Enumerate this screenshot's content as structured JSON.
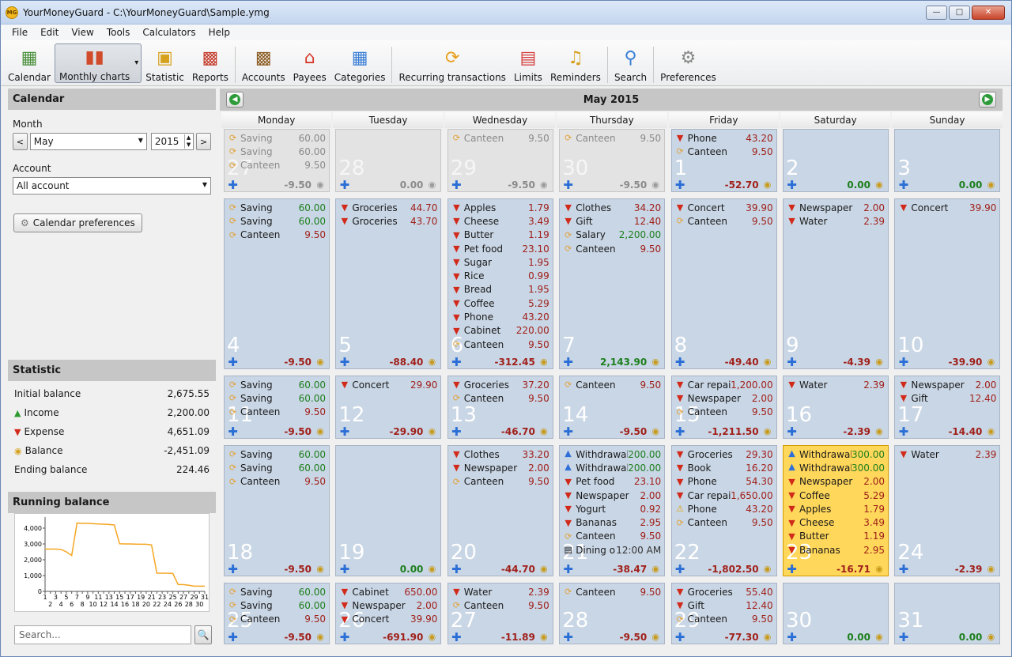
{
  "window": {
    "title": "YourMoneyGuard - C:\\YourMoneyGuard\\Sample.ymg",
    "icon_text": "MG"
  },
  "menu": [
    "File",
    "Edit",
    "View",
    "Tools",
    "Calculators",
    "Help"
  ],
  "toolbar": [
    {
      "label": "Calendar",
      "icon": "calendar-icon"
    },
    {
      "label": "Monthly charts",
      "icon": "bar-chart-icon",
      "active": true
    },
    {
      "label": "Statistic",
      "icon": "coins-table-icon"
    },
    {
      "label": "Reports",
      "icon": "report-icon"
    },
    {
      "label": "Accounts",
      "icon": "wallet-icon"
    },
    {
      "label": "Payees",
      "icon": "shop-icon"
    },
    {
      "label": "Categories",
      "icon": "grid-icon"
    },
    {
      "label": "Recurring transactions",
      "icon": "recycle-icon"
    },
    {
      "label": "Limits",
      "icon": "limits-icon"
    },
    {
      "label": "Reminders",
      "icon": "bell-icon"
    },
    {
      "label": "Search",
      "icon": "magnifier-icon"
    },
    {
      "label": "Preferences",
      "icon": "gear-icon"
    }
  ],
  "left": {
    "calendar_title": "Calendar",
    "month_label": "Month",
    "month_value": "May",
    "year_value": "2015",
    "prev": "<",
    "next": ">",
    "account_label": "Account",
    "account_value": "All account",
    "cal_prefs": "Calendar preferences",
    "statistic_title": "Statistic",
    "stats": [
      {
        "label": "Initial balance",
        "value": "2,675.55",
        "icon": ""
      },
      {
        "label": "Income",
        "value": "2,200.00",
        "icon": "up-arrow-icon"
      },
      {
        "label": "Expense",
        "value": "4,651.09",
        "icon": "down-arrow-icon"
      },
      {
        "label": "Balance",
        "value": "-2,451.09",
        "icon": "coins-icon"
      },
      {
        "label": "Ending balance",
        "value": "224.46",
        "icon": ""
      }
    ],
    "running_title": "Running balance",
    "search_placeholder": "Search..."
  },
  "calendar": {
    "month_title": "May 2015",
    "days": [
      "Monday",
      "Tuesday",
      "Wednesday",
      "Thursday",
      "Friday",
      "Saturday",
      "Sunday"
    ]
  },
  "chart_data": {
    "type": "line",
    "x": [
      1,
      2,
      3,
      4,
      5,
      6,
      7,
      8,
      9,
      10,
      11,
      12,
      13,
      14,
      15,
      16,
      17,
      18,
      19,
      20,
      21,
      22,
      23,
      24,
      25,
      26,
      27,
      28,
      29,
      30,
      31
    ],
    "values": [
      2676,
      2676,
      2676,
      2653,
      2500,
      2270,
      4320,
      4300,
      4300,
      4280,
      4260,
      4250,
      4230,
      4200,
      3010,
      3000,
      3000,
      2990,
      2980,
      2980,
      2940,
      1150,
      1150,
      1150,
      1130,
      430,
      430,
      390,
      330,
      330,
      330
    ],
    "yticks": [
      "0",
      "1,000",
      "2,000",
      "3,000",
      "4,000"
    ],
    "ylim": [
      0,
      4500
    ],
    "xticks_top": [
      "1",
      "3",
      "5",
      "7",
      "9",
      "11",
      "13",
      "15",
      "17",
      "19",
      "21",
      "23",
      "25",
      "27",
      "29",
      "31"
    ],
    "xticks_bottom": [
      "2",
      "4",
      "6",
      "8",
      "10",
      "12",
      "14",
      "16",
      "18",
      "20",
      "22",
      "24",
      "26",
      "28",
      "30"
    ],
    "color": "#f5a623"
  },
  "weeks": [
    [
      {
        "d": "27",
        "other": true,
        "tx": [
          [
            "rec",
            "Saving",
            "60.00"
          ],
          [
            "rec",
            "Saving",
            "60.00"
          ],
          [
            "rec",
            "Canteen",
            "9.50"
          ]
        ],
        "total": "-9.50"
      },
      {
        "d": "28",
        "other": true,
        "tx": [],
        "total": "0.00"
      },
      {
        "d": "29",
        "other": true,
        "tx": [
          [
            "rec",
            "Canteen",
            "9.50"
          ]
        ],
        "total": "-9.50"
      },
      {
        "d": "30",
        "other": true,
        "tx": [
          [
            "rec",
            "Canteen",
            "9.50"
          ]
        ],
        "total": "-9.50"
      },
      {
        "d": "1",
        "tx": [
          [
            "down",
            "Phone",
            "43.20"
          ],
          [
            "rec",
            "Canteen",
            "9.50"
          ]
        ],
        "total": "-52.70"
      },
      {
        "d": "2",
        "tx": [],
        "total": "0.00"
      },
      {
        "d": "3",
        "tx": [],
        "total": "0.00"
      }
    ],
    [
      {
        "d": "4",
        "tx": [
          [
            "rec",
            "Saving",
            "60.00"
          ],
          [
            "rec",
            "Saving",
            "60.00"
          ],
          [
            "rec",
            "Canteen",
            "9.50"
          ]
        ],
        "total": "-9.50"
      },
      {
        "d": "5",
        "tx": [
          [
            "down",
            "Groceries",
            "44.70"
          ],
          [
            "down",
            "Groceries",
            "43.70"
          ]
        ],
        "total": "-88.40"
      },
      {
        "d": "6",
        "tx": [
          [
            "down",
            "Apples",
            "1.79"
          ],
          [
            "down",
            "Cheese",
            "3.49"
          ],
          [
            "down",
            "Butter",
            "1.19"
          ],
          [
            "down",
            "Pet food",
            "23.10"
          ],
          [
            "down",
            "Sugar",
            "1.95"
          ],
          [
            "down",
            "Rice",
            "0.99"
          ],
          [
            "down",
            "Bread",
            "1.95"
          ],
          [
            "down",
            "Coffee",
            "5.29"
          ],
          [
            "down",
            "Phone",
            "43.20"
          ],
          [
            "down",
            "Cabinet",
            "220.00"
          ],
          [
            "rec",
            "Canteen",
            "9.50"
          ]
        ],
        "total": "-312.45"
      },
      {
        "d": "7",
        "tx": [
          [
            "down",
            "Clothes",
            "34.20"
          ],
          [
            "down",
            "Gift",
            "12.40"
          ],
          [
            "rec",
            "Salary",
            "2,200.00"
          ],
          [
            "rec",
            "Canteen",
            "9.50"
          ]
        ],
        "total": "2,143.90"
      },
      {
        "d": "8",
        "tx": [
          [
            "down",
            "Concert",
            "39.90"
          ],
          [
            "rec",
            "Canteen",
            "9.50"
          ]
        ],
        "total": "-49.40"
      },
      {
        "d": "9",
        "tx": [
          [
            "down",
            "Newspaper",
            "2.00"
          ],
          [
            "down",
            "Water",
            "2.39"
          ]
        ],
        "total": "-4.39"
      },
      {
        "d": "10",
        "tx": [
          [
            "down",
            "Concert",
            "39.90"
          ]
        ],
        "total": "-39.90"
      }
    ],
    [
      {
        "d": "11",
        "tx": [
          [
            "rec",
            "Saving",
            "60.00"
          ],
          [
            "rec",
            "Saving",
            "60.00"
          ],
          [
            "rec",
            "Canteen",
            "9.50"
          ]
        ],
        "total": "-9.50"
      },
      {
        "d": "12",
        "tx": [
          [
            "down",
            "Concert",
            "29.90"
          ]
        ],
        "total": "-29.90"
      },
      {
        "d": "13",
        "tx": [
          [
            "down",
            "Groceries",
            "37.20"
          ],
          [
            "rec",
            "Canteen",
            "9.50"
          ]
        ],
        "total": "-46.70"
      },
      {
        "d": "14",
        "tx": [
          [
            "rec",
            "Canteen",
            "9.50"
          ]
        ],
        "total": "-9.50"
      },
      {
        "d": "15",
        "tx": [
          [
            "down",
            "Car repair",
            "1,200.00"
          ],
          [
            "down",
            "Newspaper",
            "2.00"
          ],
          [
            "rec",
            "Canteen",
            "9.50"
          ]
        ],
        "total": "-1,211.50"
      },
      {
        "d": "16",
        "tx": [
          [
            "down",
            "Water",
            "2.39"
          ]
        ],
        "total": "-2.39"
      },
      {
        "d": "17",
        "tx": [
          [
            "down",
            "Newspaper",
            "2.00"
          ],
          [
            "down",
            "Gift",
            "12.40"
          ]
        ],
        "total": "-14.40"
      }
    ],
    [
      {
        "d": "18",
        "tx": [
          [
            "rec",
            "Saving",
            "60.00"
          ],
          [
            "rec",
            "Saving",
            "60.00"
          ],
          [
            "rec",
            "Canteen",
            "9.50"
          ]
        ],
        "total": "-9.50"
      },
      {
        "d": "19",
        "tx": [],
        "total": "0.00"
      },
      {
        "d": "20",
        "tx": [
          [
            "down",
            "Clothes",
            "33.20"
          ],
          [
            "down",
            "Newspaper",
            "2.00"
          ],
          [
            "rec",
            "Canteen",
            "9.50"
          ]
        ],
        "total": "-44.70"
      },
      {
        "d": "21",
        "tx": [
          [
            "up",
            "Withdrawal",
            "200.00"
          ],
          [
            "up",
            "Withdrawal",
            "200.00"
          ],
          [
            "down",
            "Pet food",
            "23.10"
          ],
          [
            "down",
            "Newspaper",
            "2.00"
          ],
          [
            "down",
            "Yogurt",
            "0.92"
          ],
          [
            "down",
            "Bananas",
            "2.95"
          ],
          [
            "rec",
            "Canteen",
            "9.50"
          ],
          [
            "note",
            "Dining out",
            "12:00 AM"
          ]
        ],
        "total": "-38.47"
      },
      {
        "d": "22",
        "tx": [
          [
            "down",
            "Groceries",
            "29.30"
          ],
          [
            "down",
            "Book",
            "16.20"
          ],
          [
            "down",
            "Phone",
            "54.30"
          ],
          [
            "down",
            "Car repair",
            "1,650.00"
          ],
          [
            "warn",
            "Phone",
            "43.20"
          ],
          [
            "rec",
            "Canteen",
            "9.50"
          ]
        ],
        "total": "-1,802.50"
      },
      {
        "d": "23",
        "hl": true,
        "tx": [
          [
            "up",
            "Withdrawal",
            "300.00"
          ],
          [
            "up",
            "Withdrawal",
            "300.00"
          ],
          [
            "down",
            "Newspaper",
            "2.00"
          ],
          [
            "down",
            "Coffee",
            "5.29"
          ],
          [
            "down",
            "Apples",
            "1.79"
          ],
          [
            "down",
            "Cheese",
            "3.49"
          ],
          [
            "down",
            "Butter",
            "1.19"
          ],
          [
            "down",
            "Bananas",
            "2.95"
          ]
        ],
        "total": "-16.71"
      },
      {
        "d": "24",
        "tx": [
          [
            "down",
            "Water",
            "2.39"
          ]
        ],
        "total": "-2.39"
      }
    ],
    [
      {
        "d": "25",
        "tx": [
          [
            "rec",
            "Saving",
            "60.00"
          ],
          [
            "rec",
            "Saving",
            "60.00"
          ],
          [
            "rec",
            "Canteen",
            "9.50"
          ]
        ],
        "total": "-9.50"
      },
      {
        "d": "26",
        "tx": [
          [
            "down",
            "Cabinet",
            "650.00"
          ],
          [
            "down",
            "Newspaper",
            "2.00"
          ],
          [
            "down",
            "Concert",
            "39.90"
          ]
        ],
        "total": "-691.90"
      },
      {
        "d": "27",
        "tx": [
          [
            "down",
            "Water",
            "2.39"
          ],
          [
            "rec",
            "Canteen",
            "9.50"
          ]
        ],
        "total": "-11.89"
      },
      {
        "d": "28",
        "tx": [
          [
            "rec",
            "Canteen",
            "9.50"
          ]
        ],
        "total": "-9.50"
      },
      {
        "d": "29",
        "tx": [
          [
            "down",
            "Groceries",
            "55.40"
          ],
          [
            "down",
            "Gift",
            "12.40"
          ],
          [
            "rec",
            "Canteen",
            "9.50"
          ]
        ],
        "total": "-77.30"
      },
      {
        "d": "30",
        "tx": [],
        "total": "0.00"
      },
      {
        "d": "31",
        "tx": [],
        "total": "0.00"
      }
    ]
  ]
}
